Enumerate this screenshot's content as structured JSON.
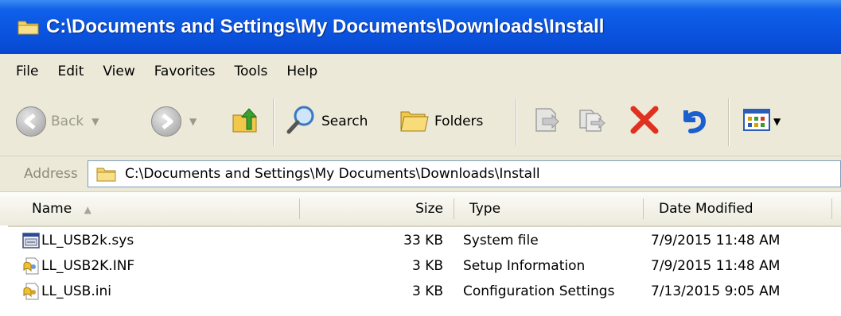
{
  "window": {
    "title": "C:\\Documents and Settings\\My Documents\\Downloads\\Install"
  },
  "menu": [
    "File",
    "Edit",
    "View",
    "Favorites",
    "Tools",
    "Help"
  ],
  "toolbar": {
    "back_label": "Back",
    "search_label": "Search",
    "folders_label": "Folders"
  },
  "address": {
    "label": "Address",
    "path": "C:\\Documents and Settings\\My Documents\\Downloads\\Install"
  },
  "columns": {
    "name": "Name",
    "size": "Size",
    "type": "Type",
    "date": "Date Modified"
  },
  "files": [
    {
      "name": "LL_USB2k.sys",
      "size": "33 KB",
      "type": "System file",
      "date": "7/9/2015 11:48 AM",
      "icon": "system-file-icon"
    },
    {
      "name": "LL_USB2K.INF",
      "size": "3 KB",
      "type": "Setup Information",
      "date": "7/9/2015 11:48 AM",
      "icon": "setup-info-icon"
    },
    {
      "name": "LL_USB.ini",
      "size": "3 KB",
      "type": "Configuration Settings",
      "date": "7/13/2015 9:05 AM",
      "icon": "config-settings-icon"
    }
  ],
  "colors": {
    "title_blue": "#0a55e0",
    "chrome": "#ece9d8",
    "delete_red": "#e03020",
    "undo_blue": "#1a5fd0"
  }
}
